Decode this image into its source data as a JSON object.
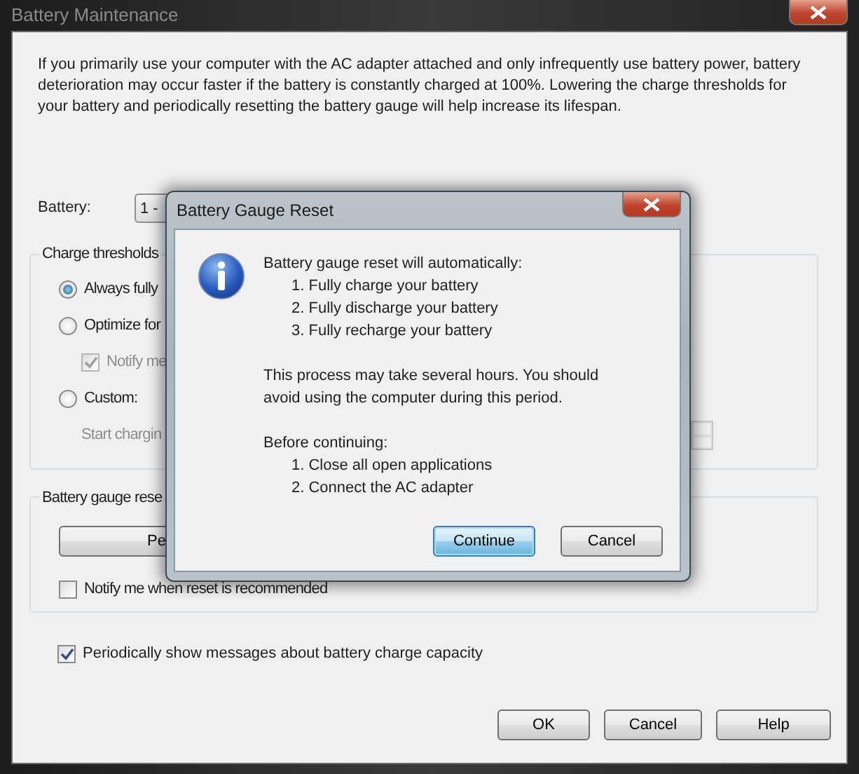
{
  "window": {
    "title": "Battery Maintenance"
  },
  "description": "If you primarily use your computer with the AC adapter attached and only infrequently use battery power, battery deterioration may occur faster if the battery is constantly charged at 100%. Lowering the charge thresholds for your battery and periodically resetting the battery gauge will help increase its lifespan.",
  "battery": {
    "label": "Battery:",
    "value": "1 -"
  },
  "charge_thresholds": {
    "title": "Charge thresholds",
    "options": [
      {
        "kind": "radio",
        "label": "Always fully",
        "selected": true,
        "disabled": false
      },
      {
        "kind": "radio",
        "label": "Optimize for",
        "selected": false,
        "disabled": false
      },
      {
        "kind": "checkbox",
        "label": "Notify me",
        "checked": true,
        "disabled": true
      },
      {
        "kind": "radio",
        "label": "Custom:",
        "selected": false,
        "disabled": false
      },
      {
        "kind": "spin",
        "label": "Start chargin",
        "disabled": true
      }
    ]
  },
  "gauge_reset": {
    "title": "Battery gauge rese",
    "button": "Pe",
    "notify": {
      "label": "Notify me when reset is recommended",
      "checked": false
    }
  },
  "periodic_messages": {
    "label": "Periodically show messages about battery charge capacity",
    "checked": true
  },
  "buttons": [
    {
      "label": "OK"
    },
    {
      "label": "Cancel"
    },
    {
      "label": "Help"
    }
  ],
  "dialog": {
    "title": "Battery Gauge Reset",
    "intro": "Battery gauge reset will automatically:",
    "steps": [
      "1. Fully charge your battery",
      "2. Fully discharge your battery",
      "3. Fully recharge your battery"
    ],
    "note": "This process may take several hours. You should avoid using the computer during this period.",
    "before": "Before continuing:",
    "before_steps": [
      "1. Close all open applications",
      "2. Connect the AC adapter"
    ],
    "buttons": [
      {
        "label": "Continue",
        "default": true
      },
      {
        "label": "Cancel",
        "default": false
      }
    ]
  }
}
